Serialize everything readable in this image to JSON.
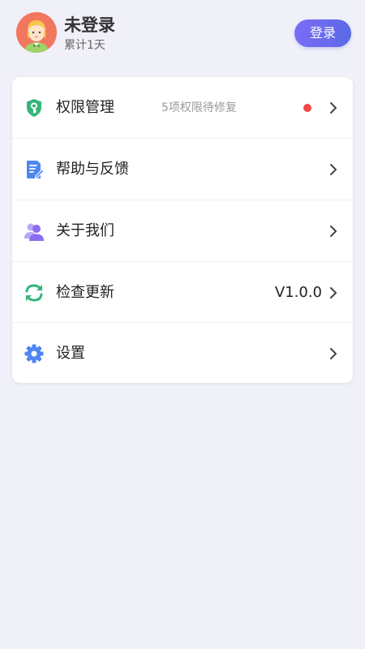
{
  "profile": {
    "name": "未登录",
    "subtitle": "累计1天",
    "avatar_icon": "cartoon-girl-avatar",
    "avatar_bg": "#f2775f"
  },
  "login_button": {
    "label": "登录",
    "gradient": [
      "#7b6cf6",
      "#5a6ae6"
    ]
  },
  "menu": {
    "items": [
      {
        "icon": "shield-key-icon",
        "icon_color": "#34b47a",
        "label": "权限管理",
        "hint": "5项权限待修复",
        "badge": "red-dot",
        "badge_color": "#f04848"
      },
      {
        "icon": "document-edit-icon",
        "icon_color": "#4f86f0",
        "label": "帮助与反馈"
      },
      {
        "icon": "users-icon",
        "icon_color": "#8b6df0",
        "label": "关于我们"
      },
      {
        "icon": "refresh-icon",
        "icon_color": "#34b47a",
        "label": "检查更新",
        "value": "V1.0.0"
      },
      {
        "icon": "gear-icon",
        "icon_color": "#4f86f0",
        "label": "设置"
      }
    ]
  },
  "colors": {
    "background": "#f0f0f8",
    "card": "#ffffff",
    "text_primary": "#222222",
    "text_secondary": "#9a9a9a"
  }
}
